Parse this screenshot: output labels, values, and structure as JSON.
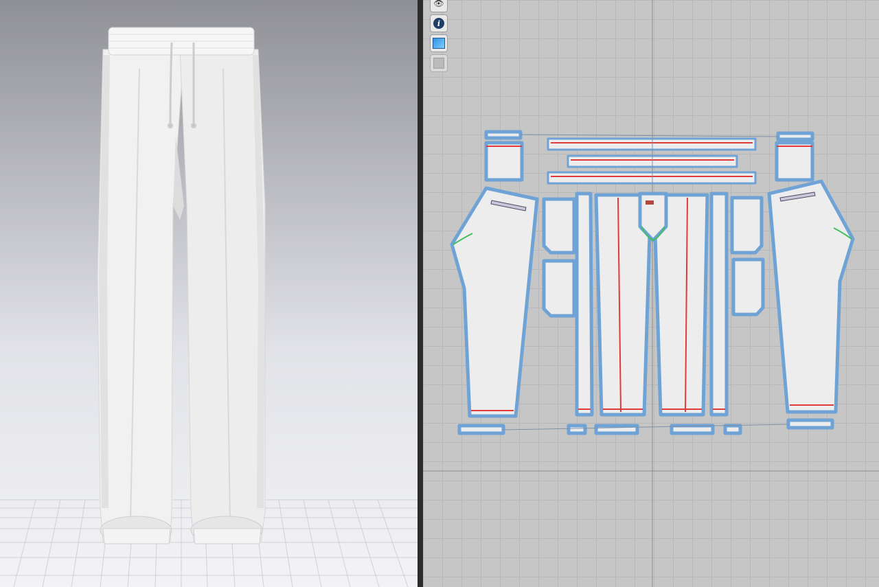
{
  "app": {
    "views": [
      "3d-avatar-window",
      "2d-pattern-window"
    ]
  },
  "toolbar_2d": {
    "buttons": [
      {
        "icon": "visibility-eye-icon"
      },
      {
        "icon": "info-icon"
      },
      {
        "icon": "texture-3d-icon"
      },
      {
        "icon": "locked-garment-icon"
      }
    ]
  },
  "colors": {
    "pattern_outline": "#6fa3d6",
    "pattern_fill": "#ededed",
    "seam_red": "#e13a3a",
    "seam_green": "#3fbf5f",
    "fabric_white": "#f2f2f2"
  }
}
